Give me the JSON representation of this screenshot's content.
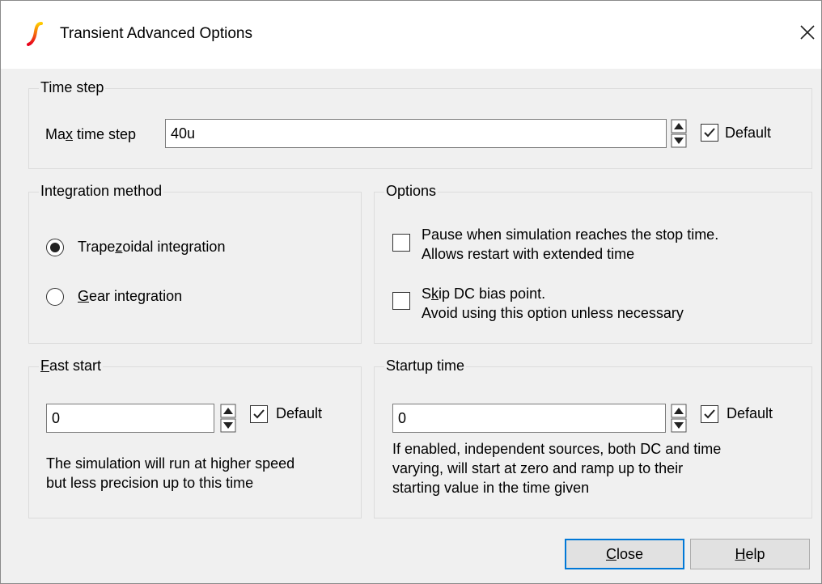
{
  "window": {
    "title": "Transient Advanced Options"
  },
  "time_step": {
    "group_title": "Time step",
    "label_pre": "Ma",
    "label_key": "x",
    "label_post": " time step",
    "value": "40u",
    "default_label": "Default",
    "default_checked": true
  },
  "integration": {
    "group_title": "Integration method",
    "options": [
      {
        "pre": "Trape",
        "key": "z",
        "post": "oidal integration",
        "selected": true
      },
      {
        "pre": "",
        "key": "G",
        "post": "ear integration",
        "selected": false
      }
    ]
  },
  "options": {
    "group_title": "Options",
    "pause": {
      "line1": "Pause when simulation reaches the stop time.",
      "line2": "Allows restart with extended time",
      "checked": false
    },
    "skip_dc": {
      "line1_pre": "S",
      "line1_key": "k",
      "line1_post": "ip DC bias point.",
      "line2": "Avoid using this option unless necessary",
      "checked": false
    }
  },
  "fast_start": {
    "group_title_key": "F",
    "group_title_rest": "ast start",
    "value": "0",
    "default_label": "Default",
    "default_checked": true,
    "desc_line1": "The simulation will run at higher speed",
    "desc_line2": "but less precision up to this time"
  },
  "startup_time": {
    "group_title": "Startup time",
    "value": "0",
    "default_label": "Default",
    "default_checked": true,
    "desc_line1": "If enabled, independent sources, both DC and time",
    "desc_line2": "varying, will start at zero and ramp up to their",
    "desc_line3": "starting value in the time given"
  },
  "buttons": {
    "close_key": "C",
    "close_rest": "lose",
    "help_key": "H",
    "help_rest": "elp"
  },
  "icons": {
    "app": "ltspice-icon",
    "close": "close-icon"
  },
  "colors": {
    "accent": "#0078d7",
    "app_icon_gradient_top": "#ffcc00",
    "app_icon_gradient_bottom": "#e8001c"
  }
}
